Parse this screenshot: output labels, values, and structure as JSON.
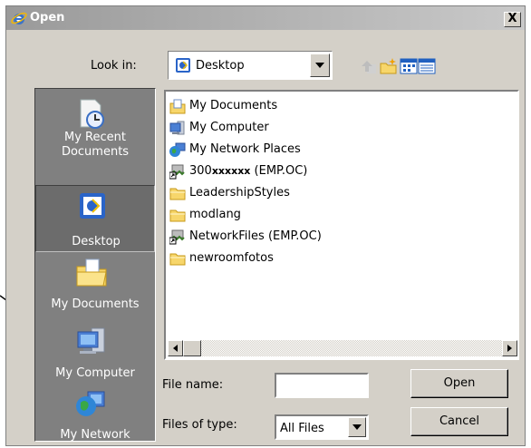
{
  "window": {
    "title": "Open",
    "close_label": "X"
  },
  "lookin": {
    "label": "Look in:",
    "value": "Desktop"
  },
  "places": [
    {
      "label": "My Recent Documents"
    },
    {
      "label": "Desktop"
    },
    {
      "label": "My Documents"
    },
    {
      "label": "My Computer"
    },
    {
      "label": "My Network"
    }
  ],
  "files": [
    {
      "name": "My Documents",
      "icon": "my-documents-icon"
    },
    {
      "name": "My Computer",
      "icon": "computer-icon"
    },
    {
      "name": "My Network Places",
      "icon": "network-places-icon"
    },
    {
      "name_prefix": "300",
      "name_masked": "xxxxxx",
      "name_suffix": " (EMP.OC)",
      "icon": "network-drive-icon"
    },
    {
      "name": "LeadershipStyles",
      "icon": "folder-icon"
    },
    {
      "name": "modlang",
      "icon": "folder-icon"
    },
    {
      "name": "NetworkFiles (EMP.OC)",
      "icon": "network-drive-icon"
    },
    {
      "name": "newroomfotos",
      "icon": "folder-icon"
    }
  ],
  "filename": {
    "label": "File name:",
    "value": ""
  },
  "filetype": {
    "label": "Files of type:",
    "value": "All Files"
  },
  "buttons": {
    "open": "Open",
    "cancel": "Cancel"
  }
}
